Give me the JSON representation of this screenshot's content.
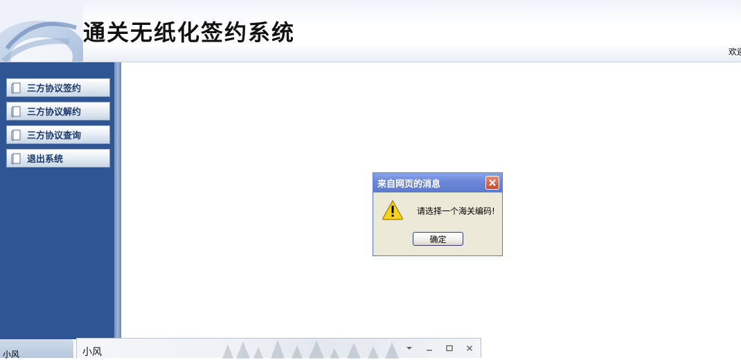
{
  "header": {
    "title": "通关无纸化签约系统",
    "welcome_text": "欢迎"
  },
  "sidebar": {
    "items": [
      {
        "label": "三方协议签约",
        "icon": "scroll-icon"
      },
      {
        "label": "三方协议解约",
        "icon": "scroll-icon"
      },
      {
        "label": "三方协议查询",
        "icon": "scroll-icon"
      },
      {
        "label": "退出系统",
        "icon": "scroll-icon"
      }
    ]
  },
  "dialog": {
    "title": "来自网页的消息",
    "message": "请选择一个海关编码!",
    "ok_label": "确定",
    "icon": "warning-icon"
  },
  "taskbar": {
    "left_label": "小风",
    "chat_title": "小风"
  },
  "colors": {
    "sidebar_bg": "#2f5592",
    "dialog_title_bg": "#6b87d8",
    "dialog_bg": "#ece9d8"
  }
}
